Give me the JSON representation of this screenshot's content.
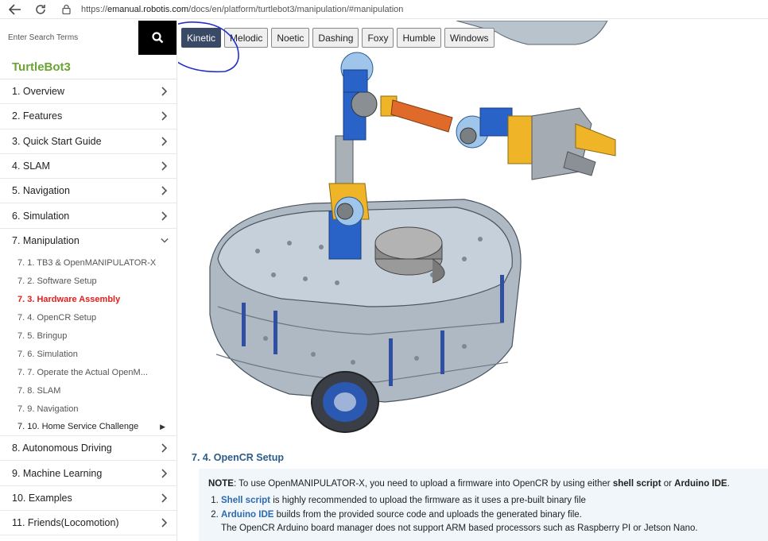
{
  "browser": {
    "url_prefix": "https://",
    "url_domain": "emanual.robotis.com",
    "url_path": "/docs/en/platform/turtlebot3/manipulation/#manipulation"
  },
  "sidebar": {
    "search_placeholder": "Enter Search Terms",
    "brand": "TurtleBot3",
    "items": [
      {
        "label": "1. Overview"
      },
      {
        "label": "2. Features"
      },
      {
        "label": "3. Quick Start Guide"
      },
      {
        "label": "4. SLAM"
      },
      {
        "label": "5. Navigation"
      },
      {
        "label": "6. Simulation"
      },
      {
        "label": "7. Manipulation"
      }
    ],
    "sub_items": [
      {
        "label": "7. 1. TB3 & OpenMANIPULATOR-X"
      },
      {
        "label": "7. 2. Software Setup"
      },
      {
        "label": "7. 3. Hardware Assembly"
      },
      {
        "label": "7. 4. OpenCR Setup"
      },
      {
        "label": "7. 5. Bringup"
      },
      {
        "label": "7. 6. Simulation"
      },
      {
        "label": "7. 7. Operate the Actual OpenM..."
      },
      {
        "label": "7. 8. SLAM"
      },
      {
        "label": "7. 9. Navigation"
      },
      {
        "label": "7. 10. Home Service Challenge"
      }
    ],
    "items_after": [
      {
        "label": "8. Autonomous Driving"
      },
      {
        "label": "9. Machine Learning"
      },
      {
        "label": "10. Examples"
      },
      {
        "label": "11. Friends(Locomotion)"
      }
    ]
  },
  "tabs": [
    "Kinetic",
    "Melodic",
    "Noetic",
    "Dashing",
    "Foxy",
    "Humble",
    "Windows"
  ],
  "active_tab": "Kinetic",
  "content": {
    "section_title": "7. 4. OpenCR Setup",
    "note_label": "NOTE",
    "note_text_1": ": To use OpenMANIPULATOR-X, you need to upload a firmware into OpenCR by using either ",
    "note_bold_1": "shell script",
    "note_text_2": " or ",
    "note_bold_2": "Arduino IDE",
    "note_text_3": ".",
    "list": [
      {
        "link": "Shell script",
        "text": " is highly recommended to upload the firmware as it uses a pre-built binary file"
      },
      {
        "link": "Arduino IDE",
        "text": " builds from the provided source code and uploads the generated binary file.",
        "sub": "The OpenCR Arduino board manager does not support ARM based processors such as Raspberry PI or Jetson Nano."
      }
    ]
  },
  "colors": {
    "brand_green": "#6aa532",
    "active_red": "#e0201c",
    "active_tab": "#3a4a66",
    "section_blue": "#2b5c8a",
    "annotation_blue": "#1f2fd0"
  }
}
